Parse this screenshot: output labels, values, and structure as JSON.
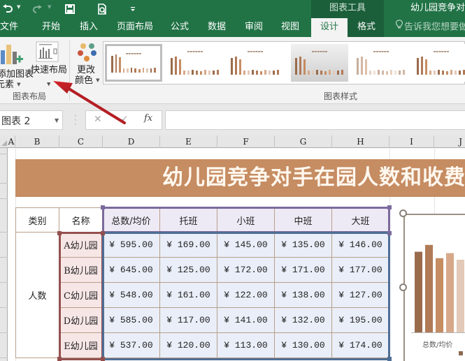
{
  "title_bar": {
    "quick_access": [
      {
        "icon": "undo-icon"
      },
      {
        "icon": "redo-icon"
      },
      {
        "icon": "save-icon"
      },
      {
        "icon": "print-preview-icon"
      },
      {
        "icon": "customize-qat-icon"
      }
    ],
    "context_tools_label": "图表工具",
    "document_title": "幼儿园竞争对手"
  },
  "tabs": [
    {
      "label": "文件"
    },
    {
      "label": "开始"
    },
    {
      "label": "插入"
    },
    {
      "label": "页面布局"
    },
    {
      "label": "公式"
    },
    {
      "label": "数据"
    },
    {
      "label": "审阅"
    },
    {
      "label": "视图"
    },
    {
      "label": "设计",
      "active": true
    },
    {
      "label": "格式"
    }
  ],
  "tell_me": {
    "icon": "lightbulb-icon",
    "placeholder": "告诉我您想要做"
  },
  "ribbon": {
    "groups": [
      {
        "label": "图表布局",
        "buttons": [
          {
            "label_line1": "添加图表",
            "label_line2": "元素",
            "icon": "add-chart-element-icon",
            "has_dropdown": true
          },
          {
            "label_line1": "快速布局",
            "icon": "quick-layout-icon",
            "has_dropdown": true
          }
        ]
      },
      {
        "label": "图表样式",
        "buttons": [
          {
            "label_line1": "更改",
            "label_line2": "颜色",
            "icon": "change-colors-icon",
            "has_dropdown": true
          }
        ],
        "style_gallery_count_visible": 6,
        "selected_style_index": 0
      }
    ],
    "palette_colors": [
      "#e8b96b",
      "#5fa08a",
      "#c9553e",
      "#e08a3c",
      "#3c6db0"
    ]
  },
  "formula_bar": {
    "name_box": "图表 2",
    "cancel_icon": "cancel-icon",
    "enter_icon": "check-icon",
    "fx_label": "fx",
    "formula": ""
  },
  "columns": [
    "A",
    "B",
    "C",
    "D",
    "E",
    "F",
    "G",
    "H",
    "I",
    "J"
  ],
  "sheet": {
    "banner_title": "幼儿园竞争对手在园人数和收费",
    "banner_color": "#c68c62",
    "table": {
      "headers": [
        "类别",
        "名称",
        "总数/均价",
        "托班",
        "小班",
        "中班",
        "大班"
      ],
      "category": "人数",
      "rows": [
        {
          "name": "A幼儿园",
          "values": [
            "¥ 595.00",
            "¥ 169.00",
            "¥ 145.00",
            "¥ 135.00",
            "¥ 146.00"
          ]
        },
        {
          "name": "B幼儿园",
          "values": [
            "¥ 645.00",
            "¥ 125.00",
            "¥ 172.00",
            "¥ 171.00",
            "¥ 177.00"
          ]
        },
        {
          "name": "C幼儿园",
          "values": [
            "¥ 548.00",
            "¥ 161.00",
            "¥ 122.00",
            "¥ 138.00",
            "¥ 127.00"
          ]
        },
        {
          "name": "D幼儿园",
          "values": [
            "¥ 585.00",
            "¥ 117.00",
            "¥ 141.00",
            "¥ 132.00",
            "¥ 195.00"
          ]
        },
        {
          "name": "E幼儿园",
          "values": [
            "¥ 537.00",
            "¥ 120.00",
            "¥ 113.00",
            "¥ 130.00",
            "¥ 174.00"
          ]
        }
      ]
    }
  },
  "chart": {
    "name": "图表 2",
    "x_category_label": "总数/均价",
    "series_values": [
      595,
      645,
      548,
      585,
      537
    ],
    "series_colors": [
      "#9a6b4b",
      "#b07a57",
      "#c68c62",
      "#d7a98a",
      "#e2c9b8"
    ],
    "legend_swatch_color": "#8c6a52"
  }
}
